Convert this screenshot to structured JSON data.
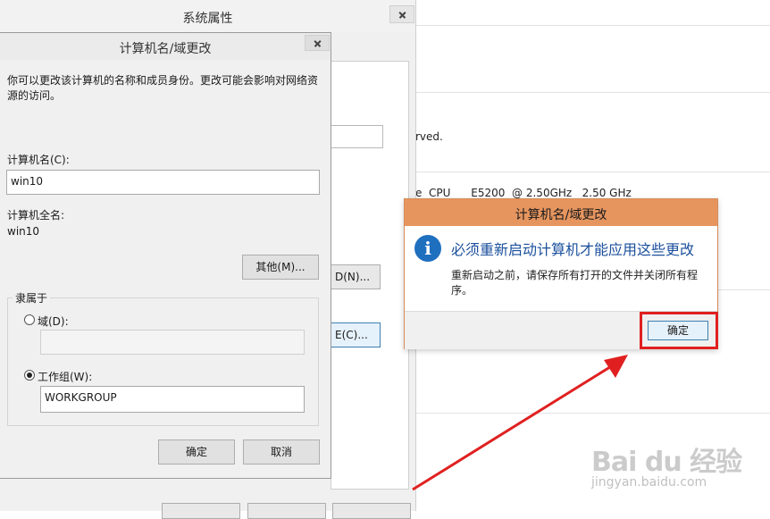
{
  "background_window": {
    "text_lines": [
      "rved.",
      "e  CPU      E5200  @ 2.50GHz   2.50 GHz"
    ]
  },
  "system_properties": {
    "title": "系统属性",
    "change_button_label": "D(N)...",
    "network_button_label": "E(C)..."
  },
  "computer_name_dialog": {
    "title": "计算机名/域更改",
    "description": "你可以更改该计算机的名称和成员身份。更改可能会影响对网络资源的访问。",
    "computer_name_label": "计算机名(C):",
    "computer_name_value": "win10",
    "full_name_label": "计算机全名:",
    "full_name_value": "win10",
    "more_button": "其他(M)...",
    "member_of_label": "隶属于",
    "domain_label": "域(D):",
    "domain_value": "",
    "workgroup_label": "工作组(W):",
    "workgroup_value": "WORKGROUP",
    "selected_membership": "workgroup",
    "ok_button": "确定",
    "cancel_button": "取消"
  },
  "restart_alert": {
    "title": "计算机名/域更改",
    "heading": "必须重新启动计算机才能应用这些更改",
    "body": "重新启动之前，请保存所有打开的文件并关闭所有程序。",
    "ok_button": "确定",
    "icon": "info-icon"
  },
  "watermark": {
    "logo": "Bai du 经验",
    "url": "jingyan.baidu.com"
  },
  "colors": {
    "alert_titlebar": "#e6955f",
    "highlight": "#e02020",
    "accent_blue": "#1f6fbf"
  }
}
